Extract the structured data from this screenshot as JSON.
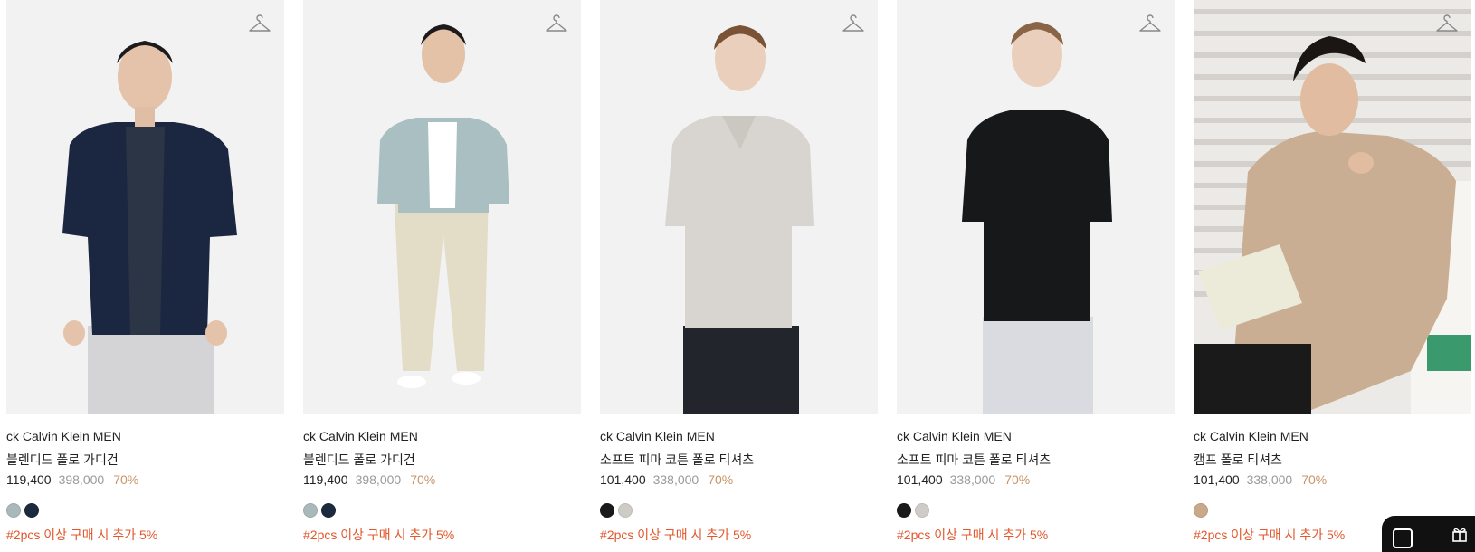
{
  "products": [
    {
      "brand": "ck Calvin Klein MEN",
      "name": "블렌디드 폴로 가디건",
      "sale_price": "119,400",
      "original_price": "398,000",
      "discount": "70%",
      "colors": [
        "#a9b8bb",
        "#1c2a3e"
      ],
      "promo": "#2pcs 이상 구매 시 추가 5%",
      "wishlist_icon": "hanger-icon"
    },
    {
      "brand": "ck Calvin Klein MEN",
      "name": "블렌디드 폴로 가디건",
      "sale_price": "119,400",
      "original_price": "398,000",
      "discount": "70%",
      "colors": [
        "#a9b8bb",
        "#1c2a3e"
      ],
      "promo": "#2pcs 이상 구매 시 추가 5%",
      "wishlist_icon": "hanger-icon"
    },
    {
      "brand": "ck Calvin Klein MEN",
      "name": "소프트 피마 코튼 폴로 티셔츠",
      "sale_price": "101,400",
      "original_price": "338,000",
      "discount": "70%",
      "colors": [
        "#1a1a1a",
        "#cfccc8"
      ],
      "promo": "#2pcs 이상 구매 시 추가 5%",
      "wishlist_icon": "hanger-icon"
    },
    {
      "brand": "ck Calvin Klein MEN",
      "name": "소프트 피마 코튼 폴로 티셔츠",
      "sale_price": "101,400",
      "original_price": "338,000",
      "discount": "70%",
      "colors": [
        "#1a1a1a",
        "#cfccc8"
      ],
      "promo": "#2pcs 이상 구매 시 추가 5%",
      "wishlist_icon": "hanger-icon"
    },
    {
      "brand": "ck Calvin Klein MEN",
      "name": "캠프 폴로 티셔츠",
      "sale_price": "101,400",
      "original_price": "338,000",
      "discount": "70%",
      "colors": [
        "#c9a98a"
      ],
      "promo": "#2pcs 이상 구매 시 추가 5%",
      "wishlist_icon": "hanger-icon"
    }
  ],
  "theme": {
    "promo_color": "#e2572c",
    "discount_color": "#c6956a",
    "original_price_color": "#9a9a9a"
  }
}
